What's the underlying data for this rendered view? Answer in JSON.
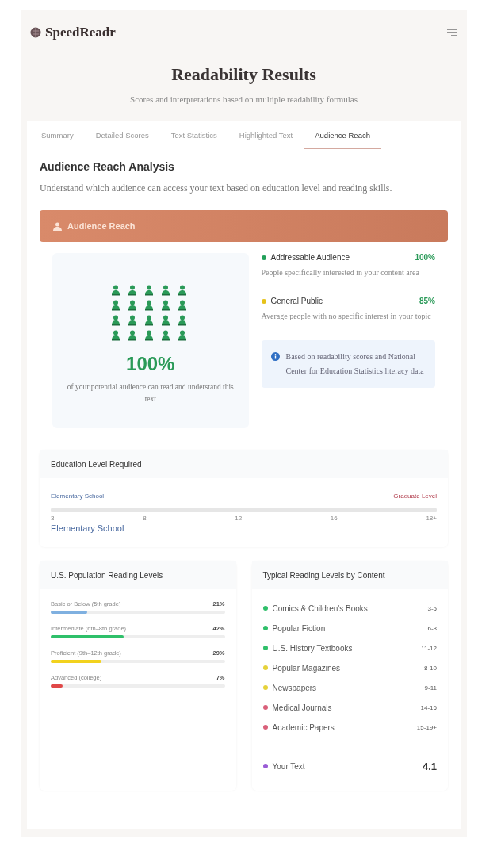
{
  "header": {
    "logo": "SpeedReadr"
  },
  "page": {
    "title": "Readability Results",
    "subtitle": "Scores and interpretations based on multiple readability formulas"
  },
  "tabs": [
    {
      "label": "Summary",
      "selected": false
    },
    {
      "label": "Detailed Scores",
      "selected": false
    },
    {
      "label": "Text Statistics",
      "selected": false
    },
    {
      "label": "Highlighted Text",
      "selected": false
    },
    {
      "label": "Audience Reach",
      "selected": true
    }
  ],
  "analysis": {
    "title": "Audience Reach Analysis",
    "description": "Understand which audience can access your text based on education level and reading skills."
  },
  "reach_card": {
    "title": "Audience Reach",
    "percent": "100%",
    "caption": "of your potential audience can read and understand this text",
    "segments": [
      {
        "name": "Addressable Audience",
        "value": "100%",
        "color": "#22a05a",
        "description": "People specifically interested in your content area"
      },
      {
        "name": "General Public",
        "value": "85%",
        "color": "#e6c21a",
        "description": "Average people with no specific interest in your topic"
      }
    ],
    "note": "Based on readability scores and National Center for Education Statistics literacy data"
  },
  "education": {
    "title": "Education Level Required",
    "left_label": "Elementary School",
    "right_label": "Graduate Level",
    "ticks": [
      "3",
      "8",
      "12",
      "16",
      "18+"
    ],
    "result": "Elementary School"
  },
  "population": {
    "title": "U.S. Population Reading Levels",
    "levels": [
      {
        "label": "Basic or Below (5th grade)",
        "value": "21%",
        "level": 0.21,
        "color": "#7fb0e0"
      },
      {
        "label": "Intermediate (6th–8th grade)",
        "value": "42%",
        "level": 0.42,
        "color": "#2fc06a"
      },
      {
        "label": "Proficient (9th–12th grade)",
        "value": "29%",
        "level": 0.29,
        "color": "#f2d21e"
      },
      {
        "label": "Advanced (college)",
        "value": "7%",
        "level": 0.07,
        "color": "#e04848"
      }
    ]
  },
  "content_levels": {
    "title": "Typical Reading Levels by Content",
    "items": [
      {
        "name": "Comics & Children's Books",
        "range": "3-5",
        "color": "#2fbf6a"
      },
      {
        "name": "Popular Fiction",
        "range": "6-8",
        "color": "#2fbf6a"
      },
      {
        "name": "U.S. History Textbooks",
        "range": "11-12",
        "color": "#2fbf6a"
      },
      {
        "name": "Popular Magazines",
        "range": "8-10",
        "color": "#e6d23a"
      },
      {
        "name": "Newspapers",
        "range": "9-11",
        "color": "#e6d23a"
      },
      {
        "name": "Medical Journals",
        "range": "14-16",
        "color": "#d9607a"
      },
      {
        "name": "Academic Papers",
        "range": "15-19+",
        "color": "#d9607a"
      }
    ],
    "your_text": {
      "name": "Your Text",
      "value": "4.1",
      "color": "#9a5cd6"
    }
  }
}
